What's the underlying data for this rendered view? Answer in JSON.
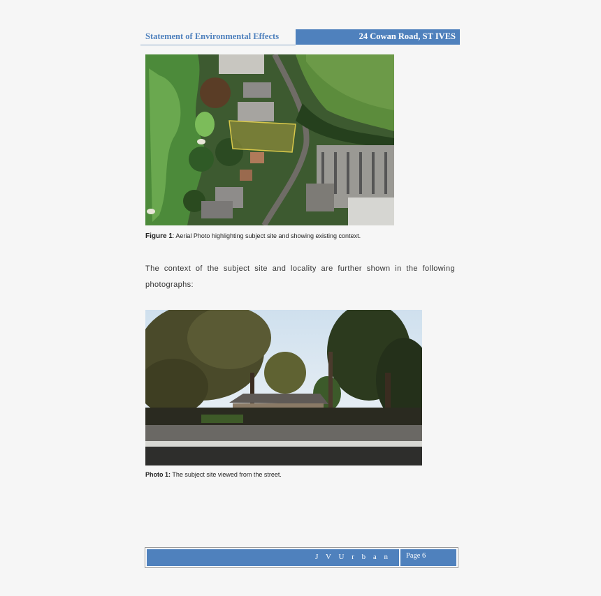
{
  "header": {
    "left_title": "Statement of Environmental Effects",
    "right_title": "24 Cowan Road, ST IVES"
  },
  "figure1": {
    "label": "Figure 1",
    "caption": ": Aerial Photo highlighting subject site and showing existing context."
  },
  "paragraph": {
    "line1": "The context of the subject site and locality are further shown in the following",
    "line2": "photographs:"
  },
  "photo1": {
    "label": "Photo 1:",
    "caption": " The subject site viewed from the street."
  },
  "footer": {
    "company": "J V U r b a n",
    "page": "Page 6"
  }
}
